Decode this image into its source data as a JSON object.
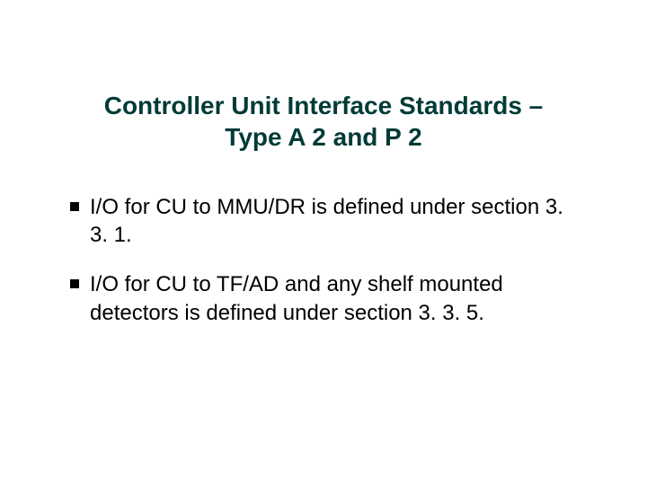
{
  "title_line1": "Controller Unit Interface Standards –",
  "title_line2": "Type A 2 and P 2",
  "bullets": [
    "I/O for CU to MMU/DR is defined under section 3. 3. 1.",
    "I/O for CU to TF/AD and any shelf mounted detectors is defined under section 3. 3. 5."
  ]
}
